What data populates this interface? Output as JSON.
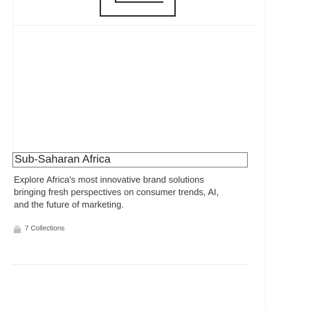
{
  "card": {
    "title": "Sub-Saharan Africa",
    "description": "Explore Africa's most innovative brand solutions bringing fresh perspectives on consumer trends, AI, and the future of marketing.",
    "collections_count": "7 Collections",
    "collections_icon": "collection-stack-icon"
  },
  "colors": {
    "title_border": "#7a7a7a",
    "text": "#3a3a3a",
    "meta_text": "#555555"
  }
}
